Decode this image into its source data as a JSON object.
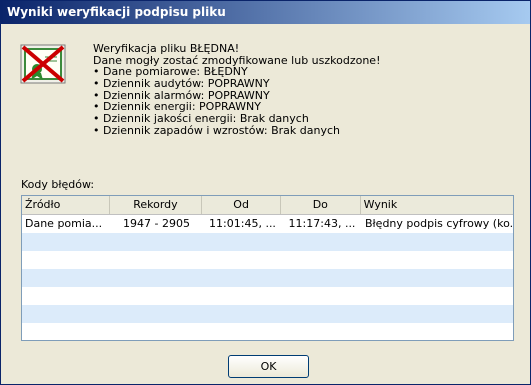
{
  "window": {
    "title": "Wyniki weryfikacji podpisu pliku"
  },
  "icon": {
    "name": "invalid-signature-certificate-icon"
  },
  "message": {
    "lines": [
      "Weryfikacja pliku BŁĘDNA!",
      "Dane mogły zostać zmodyfikowane lub uszkodzone!",
      "• Dane pomiarowe: BŁĘDNY",
      "• Dziennik audytów: POPRAWNY",
      "• Dziennik alarmów: POPRAWNY",
      "• Dziennik energii: POPRAWNY",
      "• Dziennik jakości energii: Brak danych",
      "• Dziennik zapadów i wzrostów: Brak danych"
    ]
  },
  "codes": {
    "label": "Kody błędów:",
    "columns": [
      "Źródło",
      "Rekordy",
      "Od",
      "Do",
      "Wynik"
    ],
    "rows": [
      [
        "Dane pomia...",
        "1947 - 2905",
        "11:01:45, ...",
        "11:17:43, ...",
        "Błędny podpis cyfrowy (ko..."
      ]
    ]
  },
  "buttons": {
    "ok": "OK"
  },
  "colors": {
    "accent": "#0a246a",
    "alt_row": "#dcebfa",
    "error_red": "#cc0000"
  }
}
